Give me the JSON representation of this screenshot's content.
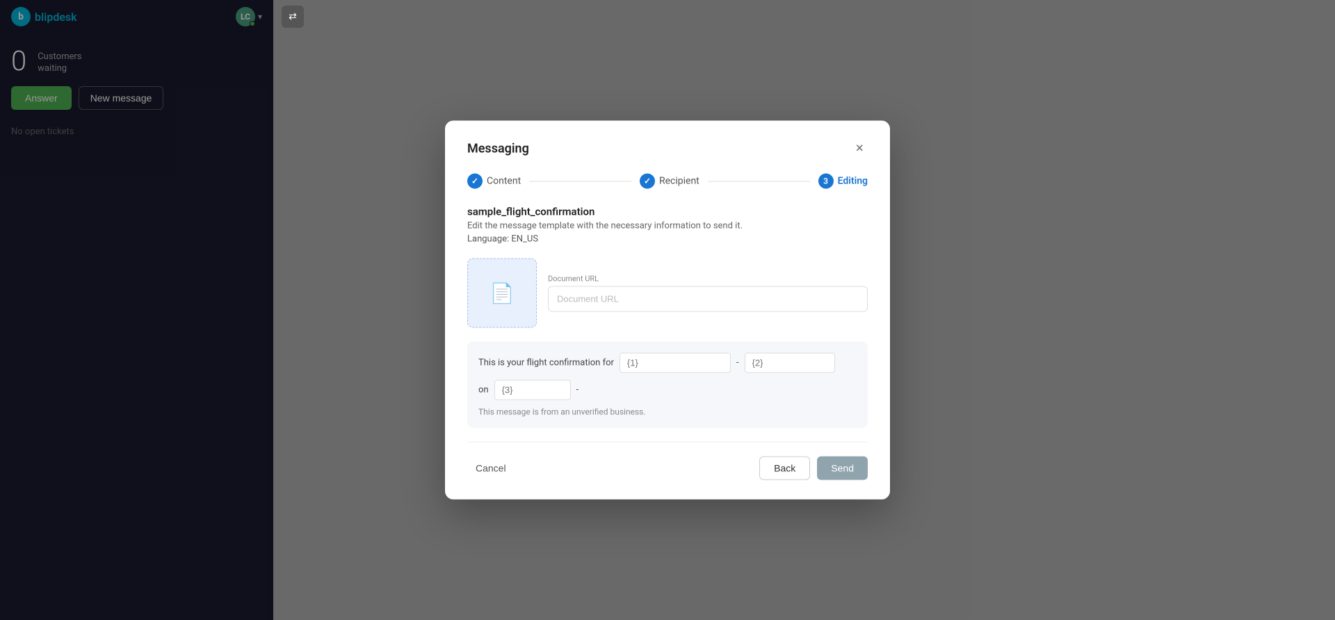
{
  "sidebar": {
    "logo_text_part1": "blip",
    "logo_text_part2": "desk",
    "avatar_initials": "LC",
    "stat_number": "0",
    "stat_label": "Customers\nwaiting",
    "btn_answer": "Answer",
    "btn_new_message": "New message",
    "no_tickets": "No open tickets"
  },
  "modal": {
    "title": "Messaging",
    "close_label": "×",
    "steps": [
      {
        "id": 1,
        "label": "Content",
        "state": "completed"
      },
      {
        "id": 2,
        "label": "Recipient",
        "state": "completed"
      },
      {
        "id": 3,
        "label": "Editing",
        "state": "active"
      }
    ],
    "template_name": "sample_flight_confirmation",
    "template_desc": "Edit the message template with the necessary information to send it.",
    "language_label": "Language: EN_US",
    "document": {
      "url_label": "Document URL",
      "url_placeholder": "Document URL"
    },
    "message": {
      "text1": "This is your flight confirmation for",
      "placeholder1": "{1}",
      "dash1": "-",
      "placeholder2": "{2}",
      "text2": "on",
      "placeholder3": "{3}",
      "dash2": "-",
      "unverified": "This message is from an unverified business."
    },
    "footer": {
      "cancel_label": "Cancel",
      "back_label": "Back",
      "send_label": "Send"
    }
  },
  "colors": {
    "accent_blue": "#1976d2",
    "sidebar_bg": "#1a1a2e",
    "answer_green": "#4caf50",
    "send_btn_bg": "#90a4ae"
  }
}
